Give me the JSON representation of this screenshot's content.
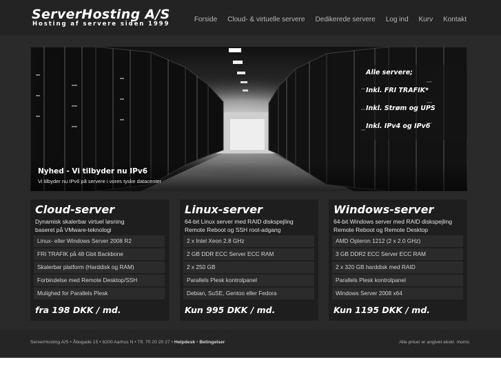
{
  "header": {
    "logo_title": "ServerHosting A/S",
    "logo_subtitle": "Hosting af servere siden 1999",
    "nav": [
      "Forside",
      "Cloud- & virtuelle servere",
      "Dedikerede servere",
      "Log ind",
      "Kurv",
      "Kontakt"
    ]
  },
  "hero": {
    "lines": [
      "Alle servere;",
      "Inkl. FRI TRAFIK*",
      "Inkl. Strøm og UPS",
      "Inkl. IPv4 og IPv6"
    ],
    "news_title": "Nyhed - Vi tilbyder nu IPv6",
    "news_text": "Vi tilbyder nu IPv6 på servere i vores tyske datacenter"
  },
  "cards": [
    {
      "title": "Cloud-server",
      "desc1": "Dynamisk skalerbar virtuel løsning",
      "desc2": "baseret på VMware-teknologi",
      "features": [
        "Linux- eller Windows Server 2008 R2",
        "FRI TRAFIK på 48 Gbit Backbone",
        "Skalerbar platform (Harddisk og RAM)",
        "Forbindelse med Remote Desktop/SSH",
        "Mulighed for Parallels Plesk"
      ],
      "price": "fra 198 DKK / md."
    },
    {
      "title": "Linux-server",
      "desc1": "64-bit Linux server med RAID diskspejling",
      "desc2": "Remote Reboot og SSH root-adgang",
      "features": [
        "2 x Intel Xeon 2.8 GHz",
        "2 GB DDR ECC Server ECC RAM",
        "2 x 250 GB",
        "Parallels Plesk kontrolpanel",
        "Debian, SuSE, Gentoo eller Fedora"
      ],
      "price": "Kun 995 DKK / md."
    },
    {
      "title": "Windows-server",
      "desc1": "64-bit Windows server med RAID diskspejling",
      "desc2": "Remote Reboot og Remote Desktop",
      "features": [
        "AMD Opteron 1212 (2 x 2.0 GHz)",
        "3 GB DDR2 ECC Server ECC RAM",
        "2 x 320 GB harddisk med RAID",
        "Parallels Plesk kontrolpanel",
        "Windows Server 2008 x64"
      ],
      "price": "Kun 1195 DKK / md."
    }
  ],
  "footer": {
    "address": "ServerHosting A/S • Åbogade 15 • 8200 Aarhus N • Tlf. 70 20 20 27 •",
    "helpdesk": "Helpdesk",
    "separator": "•",
    "terms": "Betingelser",
    "note": "Alle priser er angivet ekskl. moms"
  }
}
